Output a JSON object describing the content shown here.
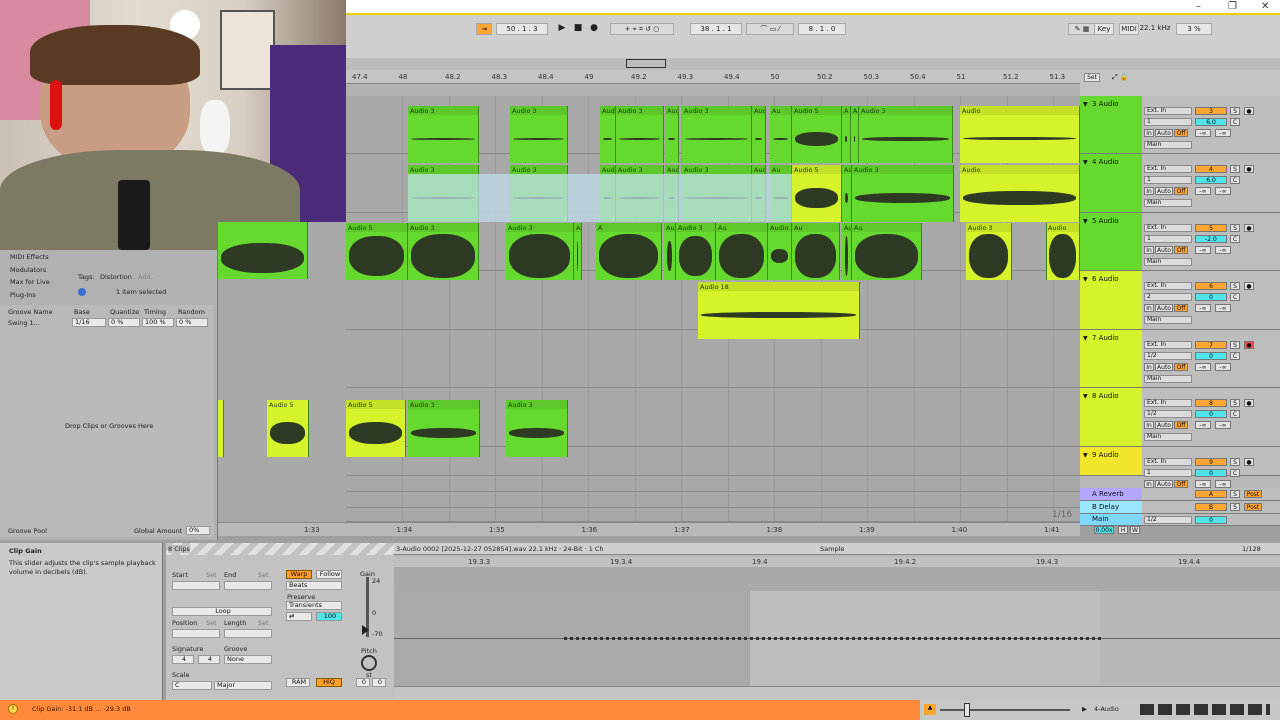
{
  "title_bar": {
    "minimize": "–",
    "restore": "❐",
    "close": "✕"
  },
  "transport": {
    "position": "50 . 1 . 3",
    "loop_start": "38 . 1 . 1",
    "loop_length": "8 . 1 . 0",
    "key_label": "Key",
    "midi_label": "MIDI",
    "sample_rate": "22.1 kHz",
    "cpu": "3 %"
  },
  "ruler": {
    "bars": [
      "47.4",
      "48",
      "48.2",
      "48.3",
      "48.4",
      "49",
      "49.2",
      "49.3",
      "49.4",
      "50",
      "50.2",
      "50.3",
      "50.4",
      "51",
      "51.2",
      "51.3"
    ],
    "set_label": "Set"
  },
  "time_ruler": {
    "times": [
      "1:33",
      "1:34",
      "1:35",
      "1:36",
      "1:37",
      "1:38",
      "1:39",
      "1:40",
      "1:41"
    ],
    "zoom": "1/16"
  },
  "tracks": [
    {
      "name": "3 Audio",
      "num": "3",
      "vol": "6.0",
      "input": "Ext. In",
      "channel": "1",
      "out": "Main",
      "color": "#65d92d"
    },
    {
      "name": "4 Audio",
      "num": "4",
      "vol": "6.0",
      "input": "Ext. In",
      "channel": "1",
      "out": "Main",
      "color": "#65d92d"
    },
    {
      "name": "5 Audio",
      "num": "5",
      "vol": "-2.0",
      "input": "Ext. In",
      "channel": "1",
      "out": "Main",
      "color": "#65d92d"
    },
    {
      "name": "6 Audio",
      "num": "6",
      "vol": "0",
      "input": "Ext. In",
      "channel": "2",
      "out": "Main",
      "color": "#d6f22b"
    },
    {
      "name": "7 Audio",
      "num": "7",
      "vol": "0",
      "input": "Ext. In",
      "channel": "1/2",
      "out": "Main",
      "color": "#d6f22b"
    },
    {
      "name": "8 Audio",
      "num": "8",
      "vol": "0",
      "input": "Ext. In",
      "channel": "1/2",
      "out": "Main",
      "color": "#d6f22b"
    },
    {
      "name": "9 Audio",
      "num": "9",
      "vol": "0",
      "input": "Ext. In",
      "channel": "1",
      "out": "Main",
      "color": "#f2e62b"
    }
  ],
  "returns": [
    {
      "name": "A Reverb",
      "letter": "A",
      "send": "Post"
    },
    {
      "name": "B Delay",
      "letter": "B",
      "send": "Post"
    }
  ],
  "main": {
    "name": "Main",
    "channel": "1/2",
    "vol": "0",
    "cue": "0.00x",
    "h": "H",
    "w": "W"
  },
  "io_labels": {
    "in": "In",
    "auto": "Auto",
    "off": "Off",
    "inf": "-∞"
  },
  "clips": {
    "track3": [
      "Audio 3",
      "Audio 3",
      "Aud",
      "Audio 3",
      "Aud",
      "Audio 3",
      "Aud",
      "Au",
      "Audio 5",
      "A",
      "Au",
      "Audio 3",
      "Audio"
    ],
    "track4": [
      "Audio 3",
      "Audio 3",
      "Aud",
      "Audio 3",
      "Aud",
      "Audio 3",
      "Aud",
      "Au",
      "Audio 5",
      "Au",
      "Audio 3",
      "Audio"
    ],
    "track5": [
      "Audio 5",
      "Audio 3",
      "Audio 3",
      "Audio 3",
      "A",
      "Audio 3",
      "Audio 3",
      "Au",
      "Audio 3",
      "Au",
      "Audio 5",
      "Au",
      "Audio 3",
      "Audio",
      "Audio"
    ],
    "track6": [
      "Audio 18"
    ],
    "track8": [
      "Audio 5",
      "Audio 5",
      "Audio 3",
      "Audio 3"
    ]
  },
  "browser": {
    "items": [
      "MIDI Effects",
      "Modulators",
      "Max for Live",
      "Plug-Ins"
    ],
    "tags_label": "Tags:",
    "tag": "Distortion",
    "add": "Add...",
    "selected": "1 item selected"
  },
  "groove": {
    "headers": [
      "Groove Name",
      "Base",
      "Quantize",
      "Timing",
      "Random"
    ],
    "row": {
      "name": "Swing 1...",
      "base": "1/16",
      "quantize": "0 %",
      "timing": "100 %",
      "random": "0 %"
    },
    "drop_text": "Drop Clips or Grooves Here",
    "pool_label": "Groove Pool",
    "global_label": "Global Amount",
    "global_value": "0%"
  },
  "clip_gain_info": {
    "title": "Clip Gain",
    "text": "This slider adjusts the clip's sample playback volume in decibels (dB)."
  },
  "clip_props": {
    "title": "8 Clips",
    "start": "Start",
    "end": "End",
    "set": "Set",
    "loop": "Loop",
    "position": "Position",
    "length": "Length",
    "signature": "Signature",
    "sig_num": "4",
    "sig_den": "4",
    "groove": "Groove",
    "groove_val": "None",
    "scale": "Scale",
    "scale_key": "C",
    "scale_mode": "Major",
    "warp": "Warp",
    "follow": "Follow",
    "beats": "Beats",
    "preserve": "Preserve",
    "transients": "Transients",
    "val100": "100",
    "gain": "Gain",
    "gain_top": "24",
    "gain_zero": "0",
    "gain_bottom": "-70",
    "pitch": "Pitch",
    "st": "st",
    "pitch_a": "0",
    "pitch_b": "0",
    "ram": "RAM",
    "hiq": "HiQ"
  },
  "sample_editor": {
    "file": "3-Audio 0002 [2025-12-27 052854].wav  22.1 kHz · 24-Bit · 1 Ch",
    "tab": "Sample",
    "zoom": "1/128",
    "ticks": [
      "19.3.3",
      "19.3.4",
      "19.4",
      "19.4.2",
      "19.4.3",
      "19.4.4"
    ]
  },
  "status": {
    "text": "Clip Gain: -31.1 dB ... -29.3 dB",
    "track": "4-Audio"
  }
}
